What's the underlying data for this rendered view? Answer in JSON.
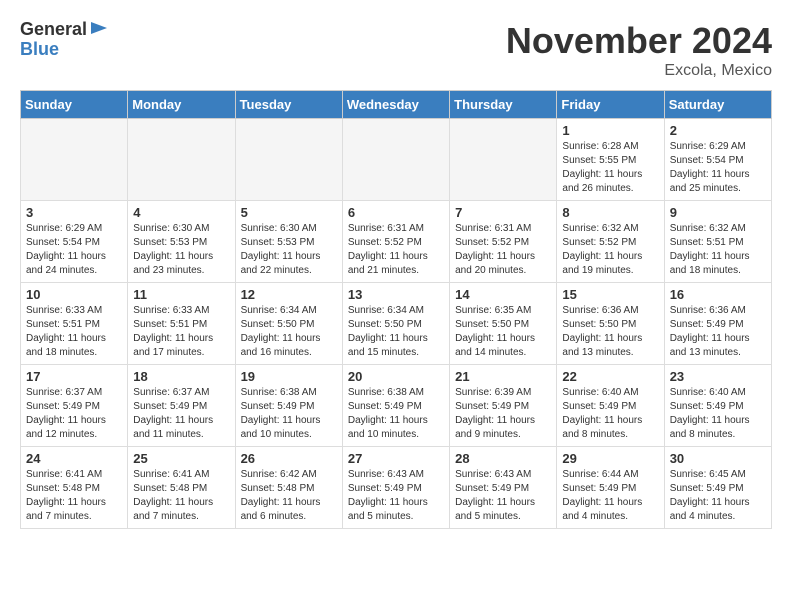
{
  "logo": {
    "general": "General",
    "blue": "Blue"
  },
  "title": "November 2024",
  "location": "Excola, Mexico",
  "days_of_week": [
    "Sunday",
    "Monday",
    "Tuesday",
    "Wednesday",
    "Thursday",
    "Friday",
    "Saturday"
  ],
  "weeks": [
    [
      {
        "day": "",
        "info": ""
      },
      {
        "day": "",
        "info": ""
      },
      {
        "day": "",
        "info": ""
      },
      {
        "day": "",
        "info": ""
      },
      {
        "day": "",
        "info": ""
      },
      {
        "day": "1",
        "info": "Sunrise: 6:28 AM\nSunset: 5:55 PM\nDaylight: 11 hours and 26 minutes."
      },
      {
        "day": "2",
        "info": "Sunrise: 6:29 AM\nSunset: 5:54 PM\nDaylight: 11 hours and 25 minutes."
      }
    ],
    [
      {
        "day": "3",
        "info": "Sunrise: 6:29 AM\nSunset: 5:54 PM\nDaylight: 11 hours and 24 minutes."
      },
      {
        "day": "4",
        "info": "Sunrise: 6:30 AM\nSunset: 5:53 PM\nDaylight: 11 hours and 23 minutes."
      },
      {
        "day": "5",
        "info": "Sunrise: 6:30 AM\nSunset: 5:53 PM\nDaylight: 11 hours and 22 minutes."
      },
      {
        "day": "6",
        "info": "Sunrise: 6:31 AM\nSunset: 5:52 PM\nDaylight: 11 hours and 21 minutes."
      },
      {
        "day": "7",
        "info": "Sunrise: 6:31 AM\nSunset: 5:52 PM\nDaylight: 11 hours and 20 minutes."
      },
      {
        "day": "8",
        "info": "Sunrise: 6:32 AM\nSunset: 5:52 PM\nDaylight: 11 hours and 19 minutes."
      },
      {
        "day": "9",
        "info": "Sunrise: 6:32 AM\nSunset: 5:51 PM\nDaylight: 11 hours and 18 minutes."
      }
    ],
    [
      {
        "day": "10",
        "info": "Sunrise: 6:33 AM\nSunset: 5:51 PM\nDaylight: 11 hours and 18 minutes."
      },
      {
        "day": "11",
        "info": "Sunrise: 6:33 AM\nSunset: 5:51 PM\nDaylight: 11 hours and 17 minutes."
      },
      {
        "day": "12",
        "info": "Sunrise: 6:34 AM\nSunset: 5:50 PM\nDaylight: 11 hours and 16 minutes."
      },
      {
        "day": "13",
        "info": "Sunrise: 6:34 AM\nSunset: 5:50 PM\nDaylight: 11 hours and 15 minutes."
      },
      {
        "day": "14",
        "info": "Sunrise: 6:35 AM\nSunset: 5:50 PM\nDaylight: 11 hours and 14 minutes."
      },
      {
        "day": "15",
        "info": "Sunrise: 6:36 AM\nSunset: 5:50 PM\nDaylight: 11 hours and 13 minutes."
      },
      {
        "day": "16",
        "info": "Sunrise: 6:36 AM\nSunset: 5:49 PM\nDaylight: 11 hours and 13 minutes."
      }
    ],
    [
      {
        "day": "17",
        "info": "Sunrise: 6:37 AM\nSunset: 5:49 PM\nDaylight: 11 hours and 12 minutes."
      },
      {
        "day": "18",
        "info": "Sunrise: 6:37 AM\nSunset: 5:49 PM\nDaylight: 11 hours and 11 minutes."
      },
      {
        "day": "19",
        "info": "Sunrise: 6:38 AM\nSunset: 5:49 PM\nDaylight: 11 hours and 10 minutes."
      },
      {
        "day": "20",
        "info": "Sunrise: 6:38 AM\nSunset: 5:49 PM\nDaylight: 11 hours and 10 minutes."
      },
      {
        "day": "21",
        "info": "Sunrise: 6:39 AM\nSunset: 5:49 PM\nDaylight: 11 hours and 9 minutes."
      },
      {
        "day": "22",
        "info": "Sunrise: 6:40 AM\nSunset: 5:49 PM\nDaylight: 11 hours and 8 minutes."
      },
      {
        "day": "23",
        "info": "Sunrise: 6:40 AM\nSunset: 5:49 PM\nDaylight: 11 hours and 8 minutes."
      }
    ],
    [
      {
        "day": "24",
        "info": "Sunrise: 6:41 AM\nSunset: 5:48 PM\nDaylight: 11 hours and 7 minutes."
      },
      {
        "day": "25",
        "info": "Sunrise: 6:41 AM\nSunset: 5:48 PM\nDaylight: 11 hours and 7 minutes."
      },
      {
        "day": "26",
        "info": "Sunrise: 6:42 AM\nSunset: 5:48 PM\nDaylight: 11 hours and 6 minutes."
      },
      {
        "day": "27",
        "info": "Sunrise: 6:43 AM\nSunset: 5:49 PM\nDaylight: 11 hours and 5 minutes."
      },
      {
        "day": "28",
        "info": "Sunrise: 6:43 AM\nSunset: 5:49 PM\nDaylight: 11 hours and 5 minutes."
      },
      {
        "day": "29",
        "info": "Sunrise: 6:44 AM\nSunset: 5:49 PM\nDaylight: 11 hours and 4 minutes."
      },
      {
        "day": "30",
        "info": "Sunrise: 6:45 AM\nSunset: 5:49 PM\nDaylight: 11 hours and 4 minutes."
      }
    ]
  ]
}
